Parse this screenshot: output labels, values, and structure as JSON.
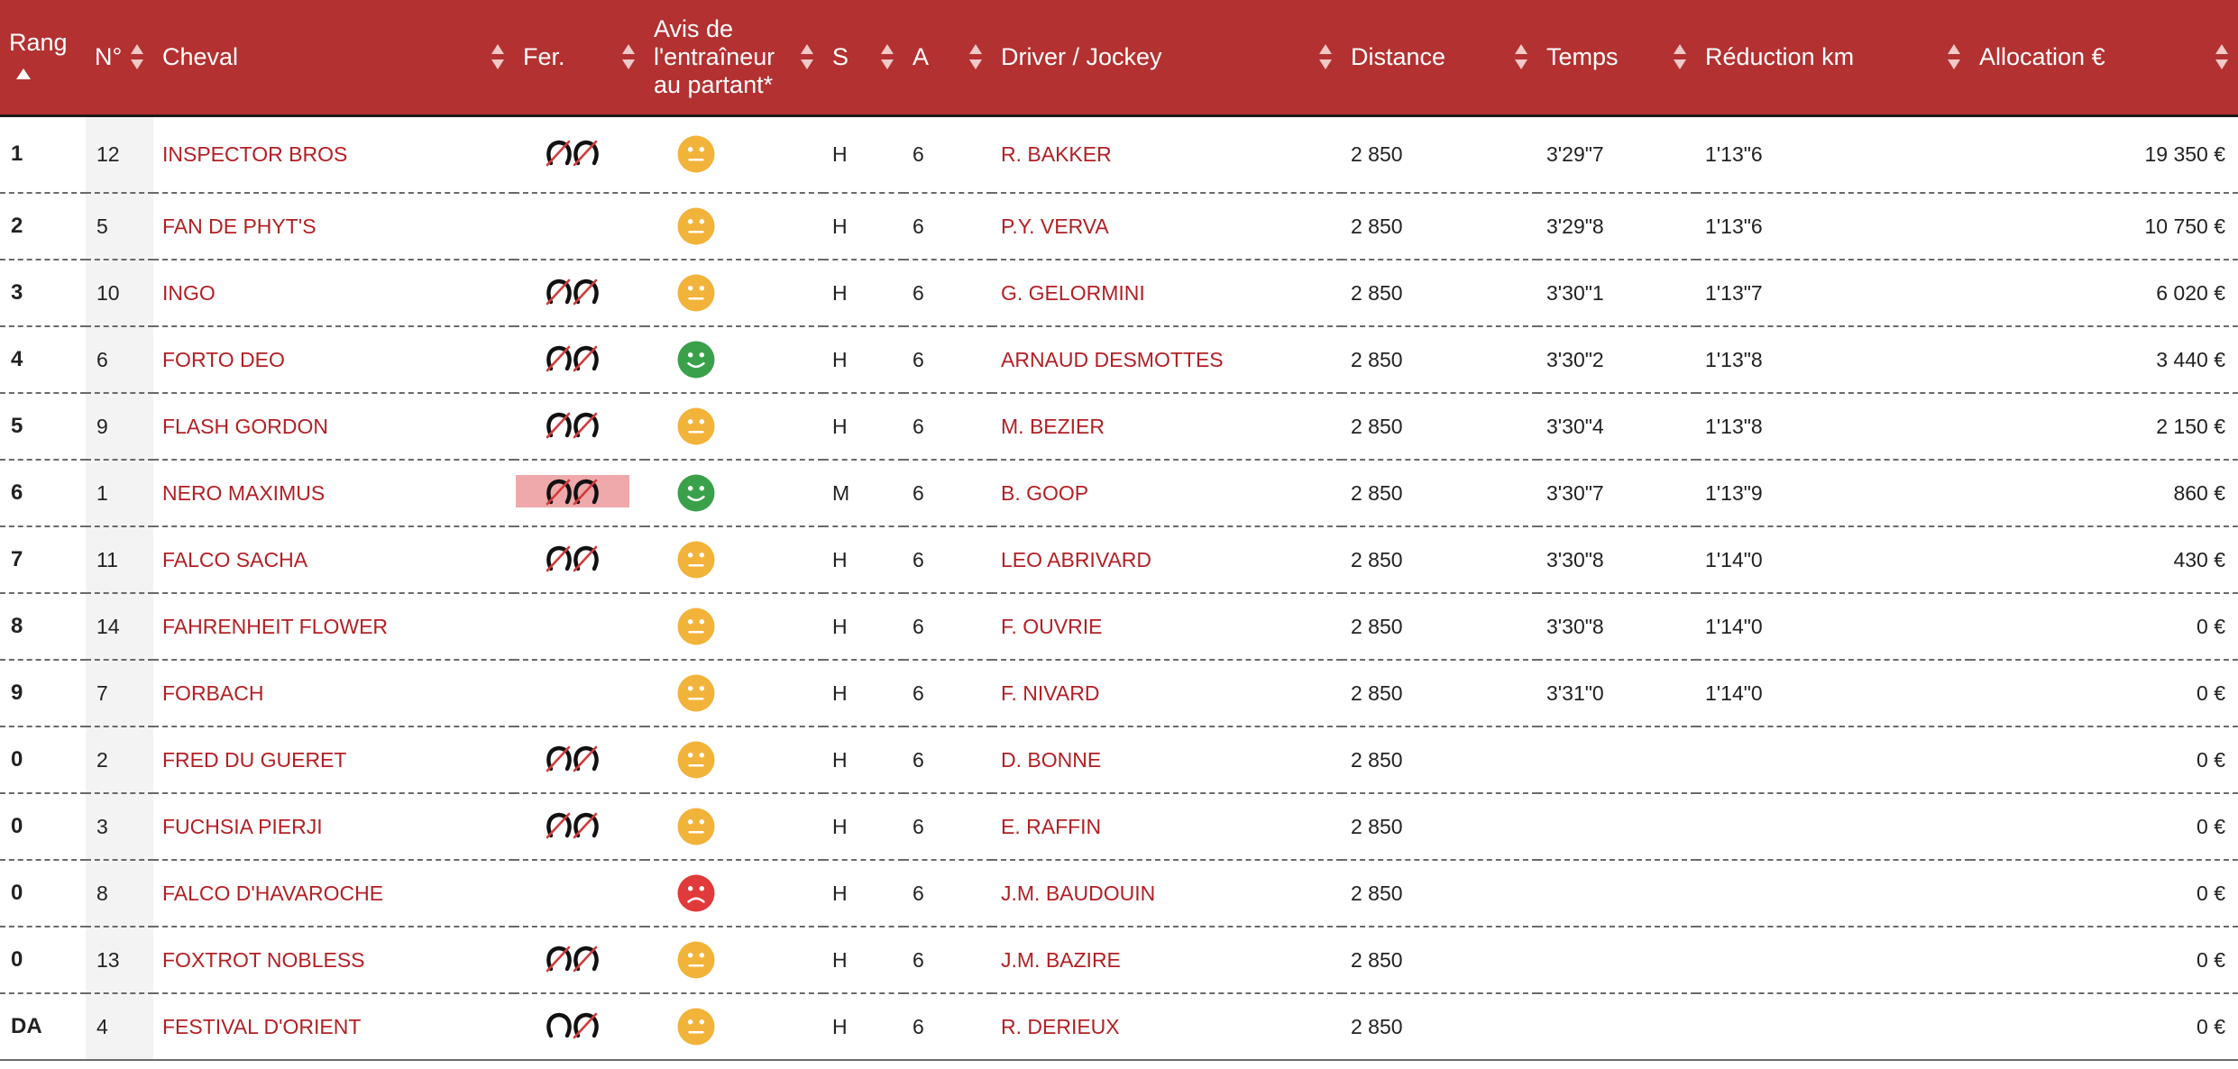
{
  "columns": {
    "rang": "Rang",
    "num": "N°",
    "cheval": "Cheval",
    "fer": "Fer.",
    "avis": "Avis de l'entraîneur au partant*",
    "sexe": "S",
    "age": "A",
    "jockey": "Driver / Jockey",
    "distance": "Distance",
    "temps": "Temps",
    "reduction": "Réduction km",
    "allocation": "Allocation €"
  },
  "colors": {
    "header_bg": "#b43131",
    "link_red": "#b31f24",
    "avis_neutral": "#f2b33a",
    "avis_positive": "#3aa14a",
    "avis_negative": "#e03a3a",
    "fer_highlight": "#efa9aa"
  },
  "rows": [
    {
      "rang": "1",
      "num": "12",
      "cheval": "INSPECTOR BROS",
      "fer": "deferre-4",
      "avis": "neutral",
      "sexe": "H",
      "age": "6",
      "jockey": "R. BAKKER",
      "distance": "2 850",
      "temps": "3'29\"7",
      "reduction": "1'13\"6",
      "allocation": "19 350 €"
    },
    {
      "rang": "2",
      "num": "5",
      "cheval": "FAN DE PHYT'S",
      "fer": "",
      "avis": "neutral",
      "sexe": "H",
      "age": "6",
      "jockey": "P.Y. VERVA",
      "distance": "2 850",
      "temps": "3'29\"8",
      "reduction": "1'13\"6",
      "allocation": "10 750 €"
    },
    {
      "rang": "3",
      "num": "10",
      "cheval": "INGO",
      "fer": "deferre-4",
      "avis": "neutral",
      "sexe": "H",
      "age": "6",
      "jockey": "G. GELORMINI",
      "distance": "2 850",
      "temps": "3'30\"1",
      "reduction": "1'13\"7",
      "allocation": "6 020 €"
    },
    {
      "rang": "4",
      "num": "6",
      "cheval": "FORTO DEO",
      "fer": "deferre-4",
      "avis": "positive",
      "sexe": "H",
      "age": "6",
      "jockey": "ARNAUD DESMOTTES",
      "distance": "2 850",
      "temps": "3'30\"2",
      "reduction": "1'13\"8",
      "allocation": "3 440 €"
    },
    {
      "rang": "5",
      "num": "9",
      "cheval": "FLASH GORDON",
      "fer": "deferre-4",
      "avis": "neutral",
      "sexe": "H",
      "age": "6",
      "jockey": "M. BEZIER",
      "distance": "2 850",
      "temps": "3'30\"4",
      "reduction": "1'13\"8",
      "allocation": "2 150 €"
    },
    {
      "rang": "6",
      "num": "1",
      "cheval": "NERO MAXIMUS",
      "fer": "deferre-4-highlight",
      "avis": "positive",
      "sexe": "M",
      "age": "6",
      "jockey": "B. GOOP",
      "distance": "2 850",
      "temps": "3'30\"7",
      "reduction": "1'13\"9",
      "allocation": "860 €"
    },
    {
      "rang": "7",
      "num": "11",
      "cheval": "FALCO SACHA",
      "fer": "deferre-4",
      "avis": "neutral",
      "sexe": "H",
      "age": "6",
      "jockey": "LEO ABRIVARD",
      "distance": "2 850",
      "temps": "3'30\"8",
      "reduction": "1'14\"0",
      "allocation": "430 €"
    },
    {
      "rang": "8",
      "num": "14",
      "cheval": "FAHRENHEIT FLOWER",
      "fer": "",
      "avis": "neutral",
      "sexe": "H",
      "age": "6",
      "jockey": "F. OUVRIE",
      "distance": "2 850",
      "temps": "3'30\"8",
      "reduction": "1'14\"0",
      "allocation": "0 €"
    },
    {
      "rang": "9",
      "num": "7",
      "cheval": "FORBACH",
      "fer": "",
      "avis": "neutral",
      "sexe": "H",
      "age": "6",
      "jockey": "F. NIVARD",
      "distance": "2 850",
      "temps": "3'31\"0",
      "reduction": "1'14\"0",
      "allocation": "0 €"
    },
    {
      "rang": "0",
      "num": "2",
      "cheval": "FRED DU GUERET",
      "fer": "deferre-4",
      "avis": "neutral",
      "sexe": "H",
      "age": "6",
      "jockey": "D. BONNE",
      "distance": "2 850",
      "temps": "",
      "reduction": "",
      "allocation": "0 €"
    },
    {
      "rang": "0",
      "num": "3",
      "cheval": "FUCHSIA PIERJI",
      "fer": "deferre-4",
      "avis": "neutral",
      "sexe": "H",
      "age": "6",
      "jockey": "E. RAFFIN",
      "distance": "2 850",
      "temps": "",
      "reduction": "",
      "allocation": "0 €"
    },
    {
      "rang": "0",
      "num": "8",
      "cheval": "FALCO D'HAVAROCHE",
      "fer": "",
      "avis": "negative",
      "sexe": "H",
      "age": "6",
      "jockey": "J.M. BAUDOUIN",
      "distance": "2 850",
      "temps": "",
      "reduction": "",
      "allocation": "0 €"
    },
    {
      "rang": "0",
      "num": "13",
      "cheval": "FOXTROT NOBLESS",
      "fer": "deferre-4",
      "avis": "neutral",
      "sexe": "H",
      "age": "6",
      "jockey": "J.M. BAZIRE",
      "distance": "2 850",
      "temps": "",
      "reduction": "",
      "allocation": "0 €"
    },
    {
      "rang": "DA",
      "num": "4",
      "cheval": "FESTIVAL D'ORIENT",
      "fer": "deferre-post",
      "avis": "neutral",
      "sexe": "H",
      "age": "6",
      "jockey": "R. DERIEUX",
      "distance": "2 850",
      "temps": "",
      "reduction": "",
      "allocation": "0 €"
    }
  ]
}
